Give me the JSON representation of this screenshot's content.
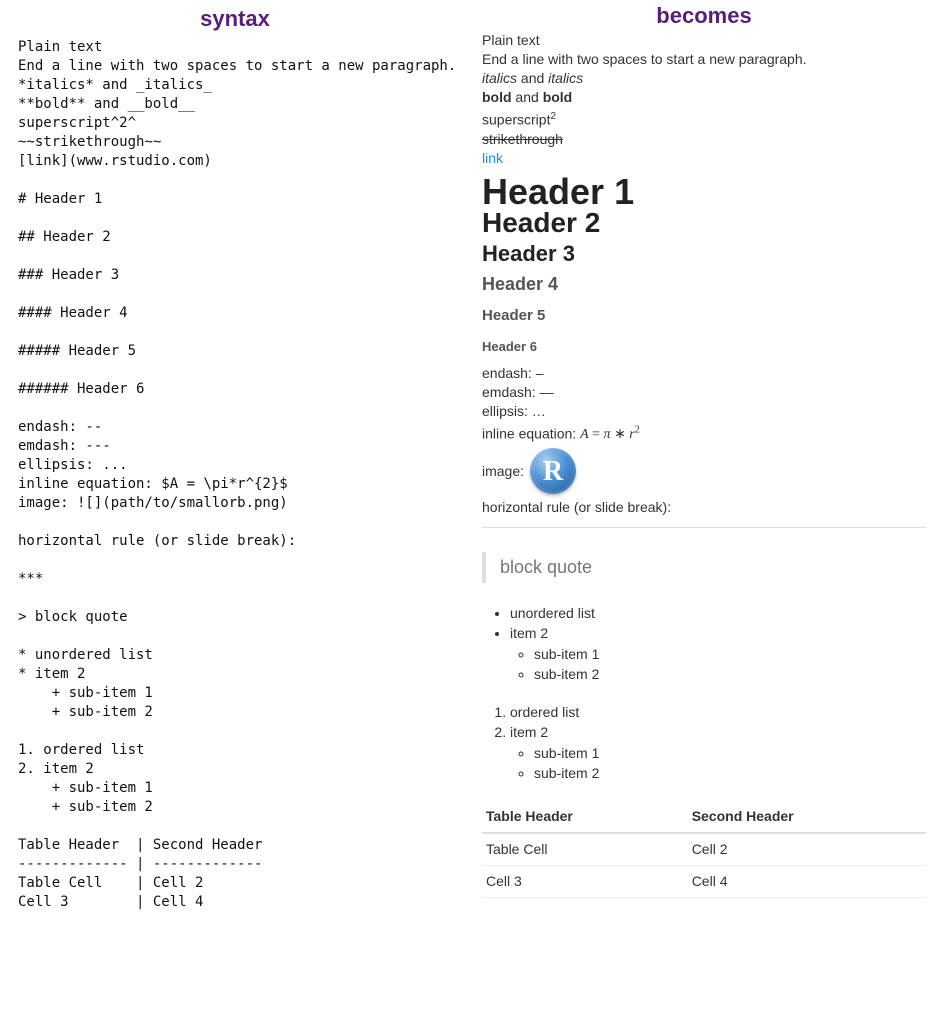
{
  "headers": {
    "left": "syntax",
    "right": "becomes"
  },
  "src": {
    "plain1": "Plain text",
    "plain2": "End a line with two spaces to start a new paragraph.",
    "italics": "*italics* and _italics_",
    "bold": "**bold** and __bold__",
    "superscript": "superscript^2^",
    "strike": "~~strikethrough~~",
    "link": "[link](www.rstudio.com)",
    "h1": "# Header 1",
    "h2": "## Header 2",
    "h3": "### Header 3",
    "h4": "#### Header 4",
    "h5": "##### Header 5",
    "h6": "###### Header 6",
    "endash": "endash: --",
    "emdash": "emdash: ---",
    "ellipsis": "ellipsis: ...",
    "inlineeq": "inline equation: $A = \\pi*r^{2}$",
    "image": "image: ![](path/to/smallorb.png)",
    "hr_label": "horizontal rule (or slide break):",
    "hr_mark": "***",
    "bq": "> block quote",
    "ul1": "* unordered list",
    "ul2": "* item 2",
    "ul_s1": "    + sub-item 1",
    "ul_s2": "    + sub-item 2",
    "ol1": "1. ordered list",
    "ol2": "2. item 2",
    "ol_s1": "    + sub-item 1",
    "ol_s2": "    + sub-item 2",
    "thead": "Table Header  | Second Header",
    "tsep": "------------- | -------------",
    "tr1": "Table Cell    | Cell 2",
    "tr2": "Cell 3        | Cell 4"
  },
  "out": {
    "plain1": "Plain text",
    "plain2": "End a line with two spaces to start a new paragraph.",
    "italics_w": "italics",
    "and_w": " and ",
    "bold_w": "bold",
    "super_base": "superscript",
    "super_exp": "2",
    "strike": "strikethrough",
    "link": "link",
    "h1": "Header 1",
    "h2": "Header 2",
    "h3": "Header 3",
    "h4": "Header 4",
    "h5": "Header 5",
    "h6": "Header 6",
    "endash": "endash: –",
    "emdash": "emdash: —",
    "ellipsis": "ellipsis: …",
    "eq_prefix": "inline equation: ",
    "eq_A": "A",
    "eq_eq": " = ",
    "eq_pi": "π",
    "eq_star": " ∗ ",
    "eq_r": "r",
    "eq_exp": "2",
    "image_label": "image:",
    "orb_letter": "R",
    "hr_label": "horizontal rule (or slide break):",
    "bq": "block quote",
    "ul": {
      "i1": "unordered list",
      "i2": "item 2",
      "s1": "sub-item 1",
      "s2": "sub-item 2"
    },
    "ol": {
      "i1": "ordered list",
      "i2": "item 2",
      "s1": "sub-item 1",
      "s2": "sub-item 2"
    },
    "table": {
      "h1": "Table Header",
      "h2": "Second Header",
      "r1c1": "Table Cell",
      "r1c2": "Cell 2",
      "r2c1": "Cell 3",
      "r2c2": "Cell 4"
    }
  }
}
